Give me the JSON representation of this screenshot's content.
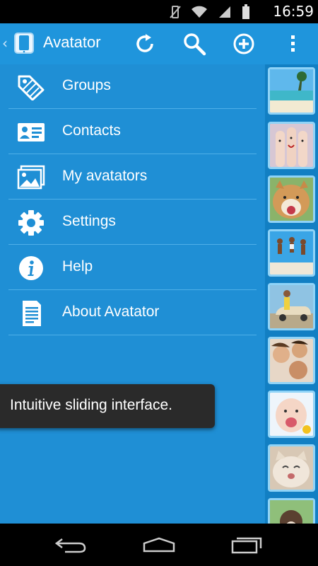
{
  "status_bar": {
    "time": "16:59",
    "icons": [
      "vibrate-off-icon",
      "wifi-icon",
      "signal-icon",
      "battery-icon"
    ]
  },
  "action_bar": {
    "title": "Avatator",
    "actions": [
      "refresh-icon",
      "search-icon",
      "add-icon",
      "overflow-icon"
    ],
    "color": "#1f95dc"
  },
  "drawer": {
    "color": "#1f8fd5",
    "items": [
      {
        "label": "Groups",
        "icon": "tag-icon"
      },
      {
        "label": "Contacts",
        "icon": "contact-card-icon"
      },
      {
        "label": "My avatators",
        "icon": "picture-icon"
      },
      {
        "label": "Settings",
        "icon": "gear-icon"
      },
      {
        "label": "Help",
        "icon": "info-icon"
      },
      {
        "label": "About Avatator",
        "icon": "document-icon"
      }
    ]
  },
  "thumbnails": [
    "beach",
    "finger-faces",
    "dog",
    "jumping-people",
    "car-woman",
    "friends",
    "baby",
    "cat",
    "dog-outdoors"
  ],
  "toast": {
    "text": "Intuitive sliding interface."
  },
  "nav_bar": {
    "buttons": [
      "back-icon",
      "home-icon",
      "recents-icon"
    ]
  }
}
